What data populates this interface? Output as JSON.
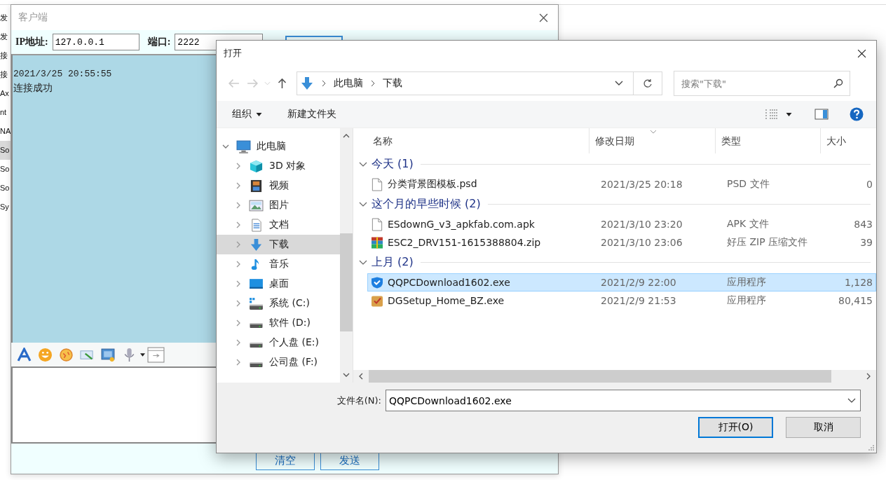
{
  "background_window": {
    "row_labels": [
      {
        "text": "发",
        "selected": false
      },
      {
        "text": "发",
        "selected": false
      },
      {
        "text": "接",
        "selected": false
      },
      {
        "text": "接",
        "selected": false
      },
      {
        "text": "Ax",
        "selected": false
      },
      {
        "text": "nt",
        "selected": false
      },
      {
        "text": "NA",
        "selected": false
      },
      {
        "text": "So",
        "selected": true
      },
      {
        "text": "So",
        "selected": false
      },
      {
        "text": "So",
        "selected": false
      },
      {
        "text": "Sy",
        "selected": false
      }
    ]
  },
  "client_window": {
    "title": "客户端",
    "ip_label": "IP地址:",
    "ip_value": "127.0.0.1",
    "port_label": "端口:",
    "port_value": "2222",
    "messages": [
      {
        "kind": "timestamp",
        "text": "2021/3/25 20:55:55"
      },
      {
        "kind": "text",
        "text": "连接成功"
      }
    ],
    "buttons": [
      "清空",
      "发送"
    ]
  },
  "open_dialog": {
    "title": "打开",
    "breadcrumb": [
      "此电脑",
      "下载"
    ],
    "search": {
      "placeholder": "搜索\"下载\""
    },
    "commands": [
      {
        "label": "组织",
        "has_menu": true
      },
      {
        "label": "新建文件夹",
        "has_menu": false
      }
    ],
    "nav_tree": [
      {
        "label": "此电脑",
        "kind": "computer",
        "expanded": true,
        "selected": false,
        "children": [
          {
            "label": "3D 对象",
            "kind": "cube",
            "expanded": false,
            "selected": false
          },
          {
            "label": "视频",
            "kind": "film",
            "expanded": false,
            "selected": false
          },
          {
            "label": "图片",
            "kind": "picture",
            "expanded": false,
            "selected": false
          },
          {
            "label": "文档",
            "kind": "document",
            "expanded": false,
            "selected": false
          },
          {
            "label": "下载",
            "kind": "download",
            "expanded": false,
            "selected": true
          },
          {
            "label": "音乐",
            "kind": "music",
            "expanded": false,
            "selected": false
          },
          {
            "label": "桌面",
            "kind": "desktop",
            "expanded": false,
            "selected": false
          },
          {
            "label": "系统 (C:)",
            "kind": "system-drive",
            "expanded": false,
            "selected": false
          },
          {
            "label": "软件 (D:)",
            "kind": "drive",
            "expanded": false,
            "selected": false
          },
          {
            "label": "个人盘 (E:)",
            "kind": "drive",
            "expanded": false,
            "selected": false
          },
          {
            "label": "公司盘 (F:)",
            "kind": "drive",
            "expanded": false,
            "selected": false
          }
        ]
      }
    ],
    "columns": [
      "名称",
      "修改日期",
      "类型",
      "大小"
    ],
    "file_groups": [
      {
        "label": "今天 (1)",
        "expanded": true,
        "files": [
          {
            "name": "分类背景图模板.psd",
            "date": "2021/3/25 20:18",
            "type": "PSD 文件",
            "size": "0",
            "kind": "blank",
            "selected": false
          }
        ]
      },
      {
        "label": "这个月的早些时候 (2)",
        "expanded": true,
        "files": [
          {
            "name": "ESdownG_v3_apkfab.com.apk",
            "date": "2021/3/10 23:20",
            "type": "APK 文件",
            "size": "843",
            "kind": "blank",
            "selected": false
          },
          {
            "name": "ESC2_DRV151-1615388804.zip",
            "date": "2021/3/10 23:06",
            "type": "好压 ZIP 压缩文件",
            "size": "39",
            "kind": "archive",
            "selected": false
          }
        ]
      },
      {
        "label": "上月 (2)",
        "expanded": true,
        "files": [
          {
            "name": "QQPCDownload1602.exe",
            "date": "2021/2/9 22:00",
            "type": "应用程序",
            "size": "1,128",
            "kind": "shield",
            "selected": true
          },
          {
            "name": "DGSetup_Home_BZ.exe",
            "date": "2021/2/9 21:53",
            "type": "应用程序",
            "size": "80,415",
            "kind": "package",
            "selected": false
          }
        ]
      }
    ],
    "filename_label": "文件名(N):",
    "filename_value": "QQPCDownload1602.exe",
    "buttons": [
      {
        "label": "打开(O)",
        "default": true
      },
      {
        "label": "取消",
        "default": false
      }
    ]
  }
}
